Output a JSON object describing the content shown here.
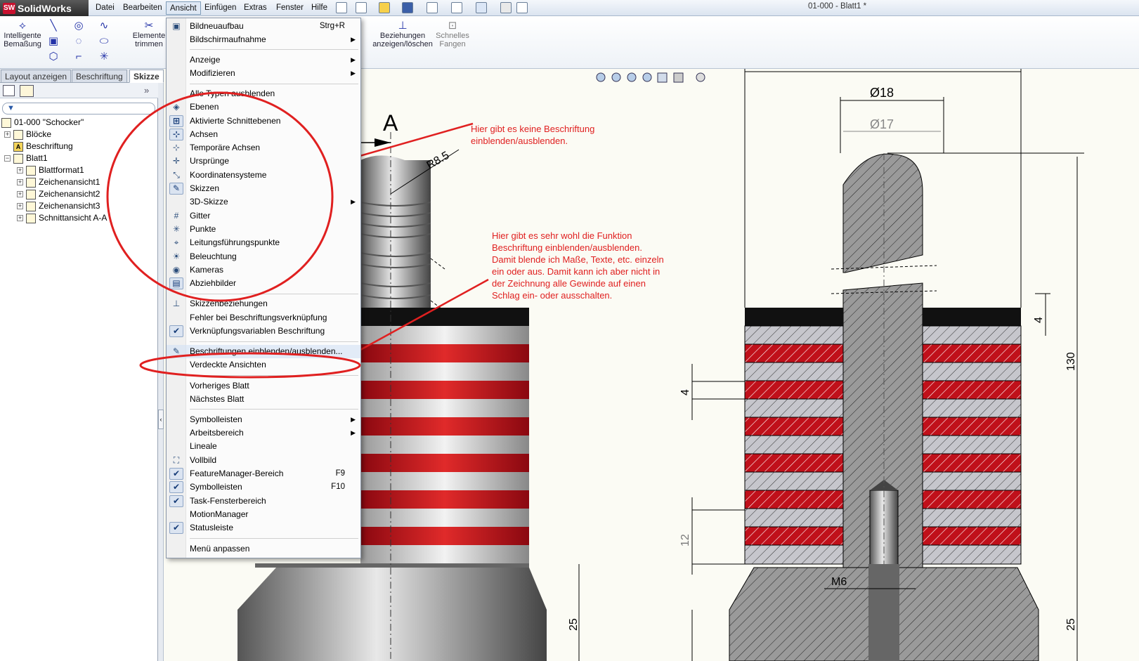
{
  "app": {
    "name": "SolidWorks",
    "logo_abbr": "SW",
    "document_title": "01-000 - Blatt1 *"
  },
  "menubar": [
    "Datei",
    "Bearbeiten",
    "Ansicht",
    "Einfügen",
    "Extras",
    "Fenster",
    "Hilfe"
  ],
  "commands": {
    "smart_dim": "Intelligente Bemaßung",
    "trim": "Elemente trimmen",
    "relations": "Beziehungen anzeigen/löschen",
    "snap": "Schnelles Fangen"
  },
  "tabs": [
    "Layout anzeigen",
    "Beschriftung",
    "Skizze"
  ],
  "tree": {
    "root": "01-000 \"Schocker\"",
    "items": [
      "Blöcke",
      "Beschriftung",
      "Blatt1",
      "Blattformat1",
      "Zeichenansicht1",
      "Zeichenansicht2",
      "Zeichenansicht3",
      "Schnittansicht A-A"
    ]
  },
  "menu_items": [
    {
      "label": "Bildneuaufbau",
      "shortcut": "Strg+R"
    },
    {
      "label": "Bildschirmaufnahme"
    },
    {
      "label": "Anzeige"
    },
    {
      "label": "Modifizieren"
    },
    {
      "label": "Alle Typen ausblenden"
    },
    {
      "label": "Ebenen"
    },
    {
      "label": "Aktivierte Schnittebenen"
    },
    {
      "label": "Achsen"
    },
    {
      "label": "Temporäre Achsen"
    },
    {
      "label": "Ursprünge"
    },
    {
      "label": "Koordinatensysteme"
    },
    {
      "label": "Skizzen"
    },
    {
      "label": "3D-Skizze"
    },
    {
      "label": "Gitter"
    },
    {
      "label": "Punkte"
    },
    {
      "label": "Leitungsführungspunkte"
    },
    {
      "label": "Beleuchtung"
    },
    {
      "label": "Kameras"
    },
    {
      "label": "Abziehbilder"
    },
    {
      "label": "Skizzenbeziehungen"
    },
    {
      "label": "Fehler bei Beschriftungsverknüpfung"
    },
    {
      "label": "Verknüpfungsvariablen Beschriftung"
    },
    {
      "label": "Beschriftungen einblenden/ausblenden..."
    },
    {
      "label": "Verdeckte Ansichten"
    },
    {
      "label": "Vorheriges Blatt"
    },
    {
      "label": "Nächstes Blatt"
    },
    {
      "label": "Symbolleisten"
    },
    {
      "label": "Arbeitsbereich"
    },
    {
      "label": "Lineale"
    },
    {
      "label": "Vollbild"
    },
    {
      "label": "FeatureManager-Bereich",
      "shortcut": "F9"
    },
    {
      "label": "Symbolleisten",
      "shortcut": "F10"
    },
    {
      "label": "Task-Fensterbereich"
    },
    {
      "label": "MotionManager"
    },
    {
      "label": "Statusleiste"
    },
    {
      "label": "Menü anpassen"
    }
  ],
  "annotations": {
    "note1": [
      "Hier gibt es keine Beschriftung",
      "einblenden/ausblenden."
    ],
    "note2": [
      "Hier gibt es sehr wohl die Funktion",
      "Beschriftung einblenden/ausblenden.",
      "Damit blende ich Maße, Texte, etc. einzeln",
      "ein oder aus. Damit kann ich aber nicht in",
      "der Zeichnung alle Gewinde auf einen",
      "Schlag ein- oder ausschalten."
    ],
    "color": "#e02020"
  },
  "drawing": {
    "section_label": "A",
    "radius": "R8.5",
    "dia_outer": "Ø18",
    "dia_inner": "Ø17",
    "dim_4_top": "4",
    "dim_130": "130",
    "dim_4_left": "4",
    "dim_12": "12",
    "thread": "M6",
    "dim_25_left": "25",
    "dim_25_right": "25"
  },
  "colors": {
    "stripe_red": "#c0101a",
    "hatch_gray": "#9a9a9a",
    "titlebar": "#dbe4f0"
  }
}
